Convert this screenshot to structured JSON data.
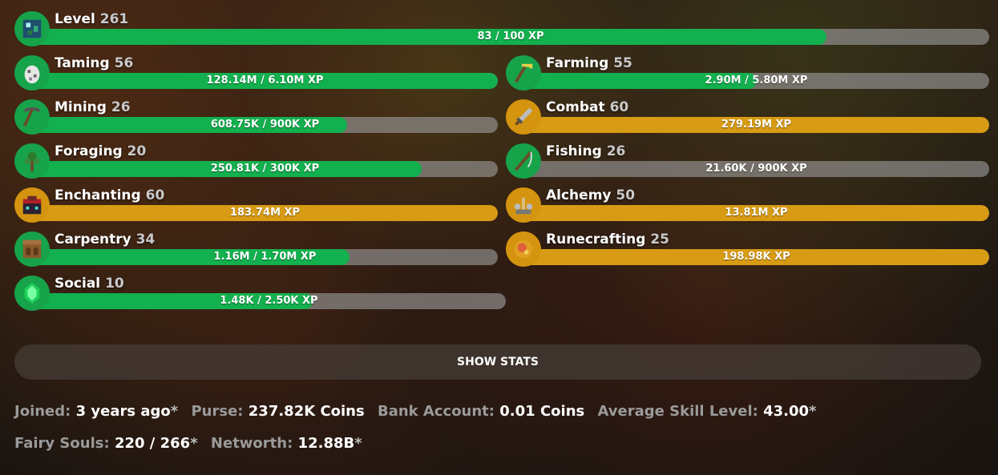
{
  "level": {
    "name": "Level",
    "level": "261",
    "text": "83 / 100 XP",
    "progress": 0.83,
    "color": "green",
    "icon": "player-head-icon"
  },
  "skills_left": [
    {
      "name": "Taming",
      "level": "56",
      "text": "128.14M / 6.10M XP",
      "progress": 1.0,
      "color": "green",
      "icon": "spawn-egg-icon"
    },
    {
      "name": "Mining",
      "level": "26",
      "text": "608.75K / 900K XP",
      "progress": 0.676,
      "color": "green",
      "icon": "pickaxe-icon"
    },
    {
      "name": "Foraging",
      "level": "20",
      "text": "250.81K / 300K XP",
      "progress": 0.836,
      "color": "green",
      "icon": "sapling-icon"
    },
    {
      "name": "Enchanting",
      "level": "60",
      "text": "183.74M XP",
      "progress": 1.0,
      "color": "gold",
      "icon": "enchanting-table-icon"
    },
    {
      "name": "Carpentry",
      "level": "34",
      "text": "1.16M / 1.70M XP",
      "progress": 0.682,
      "color": "green",
      "icon": "crafting-table-icon"
    },
    {
      "name": "Social",
      "level": "10",
      "text": "1.48K / 2.50K XP",
      "progress": 0.592,
      "color": "green",
      "icon": "emerald-icon"
    }
  ],
  "skills_right": [
    {
      "name": "Farming",
      "level": "55",
      "text": "2.90M / 5.80M XP",
      "progress": 0.5,
      "color": "green",
      "icon": "hoe-icon"
    },
    {
      "name": "Combat",
      "level": "60",
      "text": "279.19M XP",
      "progress": 1.0,
      "color": "gold",
      "icon": "sword-icon"
    },
    {
      "name": "Fishing",
      "level": "26",
      "text": "21.60K / 900K XP",
      "progress": 0.024,
      "color": "green",
      "icon": "fishing-rod-icon"
    },
    {
      "name": "Alchemy",
      "level": "50",
      "text": "13.81M XP",
      "progress": 1.0,
      "color": "gold",
      "icon": "brewing-stand-icon"
    },
    {
      "name": "Runecrafting",
      "level": "25",
      "text": "198.98K XP",
      "progress": 1.0,
      "color": "gold",
      "icon": "magma-cream-icon"
    }
  ],
  "show_stats": "SHOW STATS",
  "info": {
    "joined_label": "Joined:",
    "joined_value": "3 years ago",
    "purse_label": "Purse:",
    "purse_value": "237.82K Coins",
    "bank_label": "Bank Account:",
    "bank_value": "0.01 Coins",
    "avg_label": "Average Skill Level:",
    "avg_value": "43.00",
    "fairy_label": "Fairy Souls:",
    "fairy_value": "220 / 266",
    "networth_label": "Networth:",
    "networth_value": "12.88B",
    "star": "*"
  }
}
